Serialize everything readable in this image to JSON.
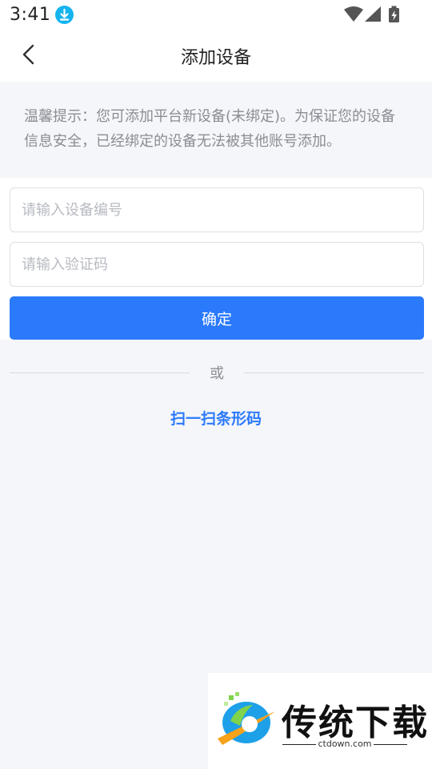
{
  "status_bar": {
    "time": "3:41",
    "download_icon": "download-arrow-icon",
    "icons": [
      "wifi-icon",
      "cellular-signal-icon",
      "battery-charging-icon"
    ]
  },
  "nav": {
    "title": "添加设备",
    "back_icon": "chevron-left-icon"
  },
  "tip": {
    "text": "温馨提示：您可添加平台新设备(未绑定)。为保证您的设备信息安全，已经绑定的设备无法被其他账号添加。"
  },
  "form": {
    "device_input": {
      "value": "",
      "placeholder": "请输入设备编号"
    },
    "code_input": {
      "value": "",
      "placeholder": "请输入验证码"
    },
    "confirm_label": "确定"
  },
  "divider": {
    "text": "或"
  },
  "scan_link": {
    "label": "扫一扫条形码"
  },
  "watermark": {
    "name": "传统下载",
    "url": "ctdown.com"
  },
  "colors": {
    "accent": "#2b7afc",
    "background": "#f5f6f9",
    "hint_text": "#8a8d94",
    "download_badge": "#14b4ef"
  }
}
